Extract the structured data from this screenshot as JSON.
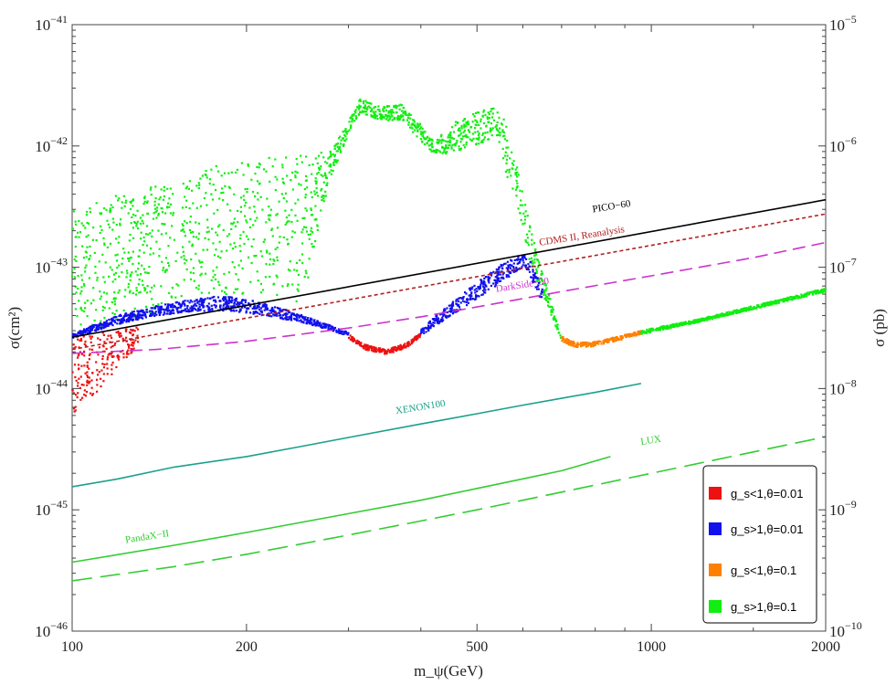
{
  "chart_data": {
    "type": "scatter",
    "xlabel": "m_ψ(GeV)",
    "ylabel_left": "σ(cm²)",
    "ylabel_right": "σ (pb)",
    "x_scale": "log",
    "y_scale": "log",
    "xlim": [
      100,
      2000
    ],
    "ylim": [
      1e-46,
      1e-41
    ],
    "x_ticks": [
      {
        "value": 100,
        "label": "100"
      },
      {
        "value": 200,
        "label": "200"
      },
      {
        "value": 500,
        "label": "500"
      },
      {
        "value": 1000,
        "label": "1000"
      },
      {
        "value": 2000,
        "label": "2000"
      }
    ],
    "y_ticks_left": [
      {
        "exp": -46,
        "base": "10",
        "sup": "−46"
      },
      {
        "exp": -45,
        "base": "10",
        "sup": "−45"
      },
      {
        "exp": -44,
        "base": "10",
        "sup": "−44"
      },
      {
        "exp": -43,
        "base": "10",
        "sup": "−43"
      },
      {
        "exp": -42,
        "base": "10",
        "sup": "−42"
      },
      {
        "exp": -41,
        "base": "10",
        "sup": "−41"
      }
    ],
    "y_ticks_right": [
      {
        "exp": -46,
        "base": "10",
        "sup": "−10"
      },
      {
        "exp": -45,
        "base": "10",
        "sup": "−9"
      },
      {
        "exp": -44,
        "base": "10",
        "sup": "−8"
      },
      {
        "exp": -43,
        "base": "10",
        "sup": "−7"
      },
      {
        "exp": -42,
        "base": "10",
        "sup": "−6"
      },
      {
        "exp": -41,
        "base": "10",
        "sup": "−5"
      }
    ],
    "grid": false,
    "legend_position": "bottom-right",
    "limit_curves": [
      {
        "name": "PICO−60",
        "color": "#000000",
        "dash": "",
        "x": [
          100,
          2000
        ],
        "y": [
          2.65e-44,
          3.6e-43
        ],
        "label_x": 855,
        "label_y": 2.8e-43
      },
      {
        "name": "CDMS II, Reanalysis",
        "color": "#b32020",
        "dash": "4,3",
        "x": [
          100,
          2000
        ],
        "y": [
          2.1e-44,
          2.75e-43
        ],
        "label_x": 760,
        "label_y": 1.6e-43
      },
      {
        "name": "DarkSide−50",
        "color": "#cc33cc",
        "dash": "14,7",
        "x": [
          100,
          140,
          200,
          300,
          400,
          500,
          700,
          1000,
          1500,
          2000
        ],
        "y": [
          1.95e-44,
          2.1e-44,
          2.45e-44,
          3.15e-44,
          3.9e-44,
          4.7e-44,
          6.3e-44,
          8.5e-44,
          1.2e-43,
          1.6e-43
        ],
        "label_x": 600,
        "label_y": 6.3e-44
      },
      {
        "name": "XENON100",
        "color": "#1aa08c",
        "dash": "",
        "x": [
          100,
          120,
          150,
          200,
          250,
          300,
          400,
          500,
          600,
          700,
          800,
          960
        ],
        "y": [
          1.55e-45,
          1.8e-45,
          2.25e-45,
          2.75e-45,
          3.35e-45,
          3.95e-45,
          5.1e-45,
          6.2e-45,
          7.3e-45,
          8.3e-45,
          9.3e-45,
          1.1e-44
        ],
        "label_x": 400,
        "label_y": 6.2e-45
      },
      {
        "name": "PandaX−II",
        "color": "#33cc33",
        "dash": "",
        "x": [
          100,
          150,
          200,
          300,
          400,
          500,
          600,
          700,
          850
        ],
        "y": [
          3.7e-46,
          5.1e-46,
          6.5e-46,
          9.3e-46,
          1.2e-45,
          1.5e-45,
          1.8e-45,
          2.1e-45,
          2.75e-45
        ],
        "label_x": 135,
        "label_y": 5.3e-46
      },
      {
        "name": "LUX",
        "color": "#33cc33",
        "dash": "22,9",
        "x": [
          100,
          150,
          200,
          300,
          400,
          500,
          700,
          1000,
          1500,
          2000
        ],
        "y": [
          2.6e-46,
          3.4e-46,
          4.3e-46,
          6.2e-46,
          8.1e-46,
          1e-45,
          1.4e-45,
          2e-45,
          3e-45,
          4e-45
        ],
        "label_x": 1000,
        "label_y": 3.3e-45
      }
    ],
    "scan_series": [
      {
        "name": "g_s<1,θ=0.01",
        "color": "#ee1111"
      },
      {
        "name": "g_s>1,θ=0.01",
        "color": "#1111ee"
      },
      {
        "name": "g_s<1,θ=0.1",
        "color": "#ff8000"
      },
      {
        "name": "g_s>1,θ=0.1",
        "color": "#11ee11"
      }
    ],
    "bands": [
      {
        "series": 3,
        "x": [
          100,
          120,
          150,
          180,
          220,
          250,
          280,
          300,
          315,
          340,
          370,
          400,
          420,
          440,
          460,
          500,
          540,
          560,
          590,
          620,
          650,
          700
        ],
        "lower": [
          2.5e-44,
          3.5e-44,
          4.5e-44,
          5.5e-44,
          5.8e-44,
          5e-44,
          5.5e-43,
          1.25e-42,
          1.9e-42,
          1.6e-42,
          1.65e-42,
          1.1e-42,
          8.5e-43,
          8.5e-43,
          9e-43,
          1e-42,
          1.2e-42,
          6e-43,
          3e-43,
          1e-43,
          6e-44,
          2.5e-44
        ],
        "upper": [
          3e-43,
          4e-43,
          5.2e-43,
          7e-43,
          8.5e-43,
          8.5e-43,
          9e-43,
          1.6e-42,
          2.5e-42,
          2.1e-42,
          2.2e-42,
          1.5e-42,
          1.1e-42,
          1.3e-42,
          1.6e-42,
          1.9e-42,
          2.1e-42,
          1.6e-42,
          6e-43,
          2e-43,
          9e-44,
          2.6e-44
        ]
      },
      {
        "series": 1,
        "x": [
          100,
          110,
          120,
          140,
          160,
          180,
          200,
          220,
          250,
          280,
          300
        ],
        "lower": [
          2.6e-44,
          3e-44,
          3.4e-44,
          4e-44,
          4.3e-44,
          4.4e-44,
          4.2e-44,
          3.9e-44,
          3.5e-44,
          3e-44,
          2.7e-44
        ],
        "upper": [
          2.8e-44,
          3.4e-44,
          4e-44,
          4.8e-44,
          5.4e-44,
          5.8e-44,
          5.5e-44,
          4.9e-44,
          4e-44,
          3.3e-44,
          2.9e-44
        ]
      },
      {
        "series": 0,
        "x": [
          100,
          110,
          120,
          130
        ],
        "lower": [
          5.5e-45,
          9e-45,
          1.5e-44,
          2.2e-44
        ],
        "upper": [
          2.6e-44,
          2.8e-44,
          3.1e-44,
          3.3e-44
        ]
      },
      {
        "series": 0,
        "x": [
          300,
          320,
          350,
          380,
          400
        ],
        "lower": [
          2.6e-44,
          2.1e-44,
          1.9e-44,
          2.2e-44,
          2.7e-44
        ],
        "upper": [
          2.8e-44,
          2.3e-44,
          2.1e-44,
          2.4e-44,
          2.9e-44
        ]
      },
      {
        "series": 1,
        "x": [
          400,
          450,
          500,
          550,
          600,
          620,
          650
        ],
        "lower": [
          2.7e-44,
          4e-44,
          5.5e-44,
          7.5e-44,
          1e-43,
          8e-44,
          5e-44
        ],
        "upper": [
          3.1e-44,
          5e-44,
          7.5e-44,
          1.05e-43,
          1.3e-43,
          1.1e-43,
          6.5e-44
        ]
      },
      {
        "series": 2,
        "x": [
          700,
          740,
          780,
          820,
          880,
          960
        ],
        "lower": [
          2.4e-44,
          2.2e-44,
          2.2e-44,
          2.3e-44,
          2.5e-44,
          2.8e-44
        ],
        "upper": [
          2.7e-44,
          2.4e-44,
          2.4e-44,
          2.5e-44,
          2.7e-44,
          3e-44
        ]
      },
      {
        "series": 3,
        "x": [
          960,
          1200,
          1500,
          2000
        ],
        "lower": [
          2.8e-44,
          3.5e-44,
          4.5e-44,
          6.3e-44
        ],
        "upper": [
          3e-44,
          3.7e-44,
          4.8e-44,
          6.7e-44
        ]
      }
    ]
  }
}
